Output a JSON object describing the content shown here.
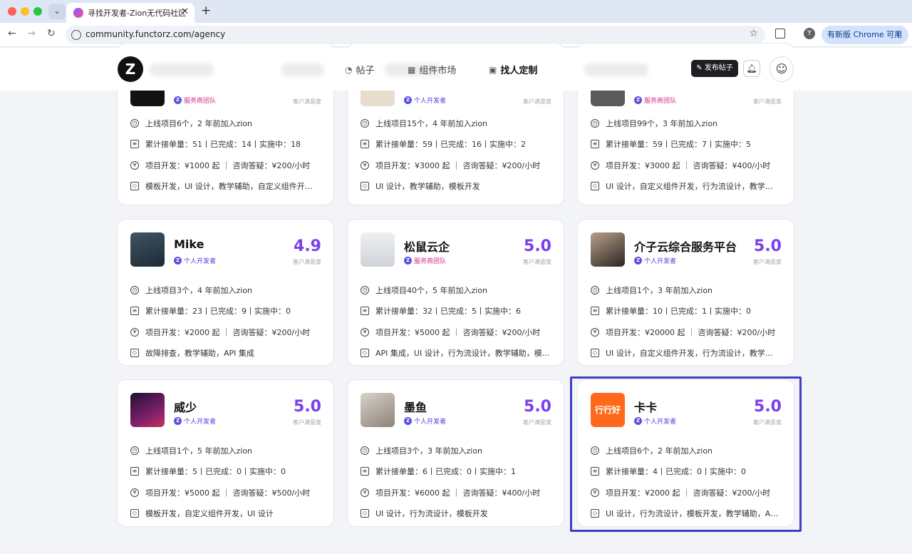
{
  "browser": {
    "tab_title": "寻找开发者-Zion无代码社区",
    "url": "community.functorz.com/agency",
    "update_label": "有新版 Chrome 可用",
    "profile_initial": "Y"
  },
  "header": {
    "logo_letter": "Z",
    "nav": [
      "帖子",
      "组件市场",
      "找人定制"
    ],
    "publish_label": "发布帖子"
  },
  "score_label": "客户满意度",
  "cards": [
    {
      "name": "",
      "badge": "服务商团队",
      "badge_type": "team",
      "score": "",
      "rows": [
        "上线项目6个，2 年前加入zion",
        "累计接单量：51丨已完成：14丨实施中：18",
        "项目开发：¥1000 起 ｜ 咨询答疑：¥200/小时",
        "模板开发，UI 设计，教学辅助，自定义组件开发..."
      ]
    },
    {
      "name": "",
      "badge": "个人开发者",
      "badge_type": "dev",
      "score": "",
      "rows": [
        "上线项目15个，4 年前加入zion",
        "累计接单量：59丨已完成：16丨实施中：2",
        "项目开发：¥3000 起 ｜ 咨询答疑：¥200/小时",
        "UI 设计，教学辅助，模板开发"
      ]
    },
    {
      "name": "",
      "badge": "服务商团队",
      "badge_type": "team",
      "score": "",
      "rows": [
        "上线项目99个，3 年前加入zion",
        "累计接单量：59丨已完成：7丨实施中：5",
        "项目开发：¥3000 起 ｜ 咨询答疑：¥400/小时",
        "UI 设计，自定义组件开发，行为流设计，教学辅..."
      ]
    },
    {
      "name": "Mike",
      "badge": "个人开发者",
      "badge_type": "dev",
      "score": "4.9",
      "rows": [
        "上线项目3个，4 年前加入zion",
        "累计接单量：23丨已完成：9丨实施中：0",
        "项目开发：¥2000 起 ｜ 咨询答疑：¥200/小时",
        "故障排查，教学辅助，API 集成"
      ]
    },
    {
      "name": "松鼠云企",
      "badge": "服务商团队",
      "badge_type": "team",
      "score": "5.0",
      "rows": [
        "上线项目40个，5 年前加入zion",
        "累计接单量：32丨已完成：5丨实施中：6",
        "项目开发：¥5000 起 ｜ 咨询答疑：¥200/小时",
        "API 集成，UI 设计，行为流设计，教学辅助，模..."
      ]
    },
    {
      "name": "介子云综合服务平台",
      "badge": "个人开发者",
      "badge_type": "dev",
      "score": "5.0",
      "rows": [
        "上线项目1个，3 年前加入zion",
        "累计接单量：10丨已完成：1丨实施中：0",
        "项目开发：¥20000 起 ｜ 咨询答疑：¥200/小时",
        "UI 设计，自定义组件开发，行为流设计，教学辅..."
      ]
    },
    {
      "name": "威少",
      "badge": "个人开发者",
      "badge_type": "dev",
      "score": "5.0",
      "rows": [
        "上线项目1个，5 年前加入zion",
        "累计接单量：5丨已完成：0丨实施中：0",
        "项目开发：¥5000 起 ｜ 咨询答疑：¥500/小时",
        "模板开发，自定义组件开发，UI 设计"
      ]
    },
    {
      "name": "墨鱼",
      "badge": "个人开发者",
      "badge_type": "dev",
      "score": "5.0",
      "rows": [
        "上线项目3个，3 年前加入zion",
        "累计接单量：6丨已完成：0丨实施中：1",
        "项目开发：¥6000 起 ｜ 咨询答疑：¥400/小时",
        "UI 设计，行为流设计，模板开发"
      ]
    },
    {
      "name": "卡卡",
      "badge": "个人开发者",
      "badge_type": "dev",
      "score": "5.0",
      "rows": [
        "上线项目6个，2 年前加入zion",
        "累计接单量：4丨已完成：0丨实施中：0",
        "项目开发：¥2000 起 ｜ 咨询答疑：¥200/小时",
        "UI 设计，行为流设计，模板开发，教学辅助，API..."
      ]
    }
  ],
  "avatar_text_kaka": "行行好",
  "colors": {
    "accent": "#7a3ef0",
    "team_badge": "#d0328a",
    "dev_badge": "#4a3ee0",
    "highlight": "#3f3fc6"
  }
}
